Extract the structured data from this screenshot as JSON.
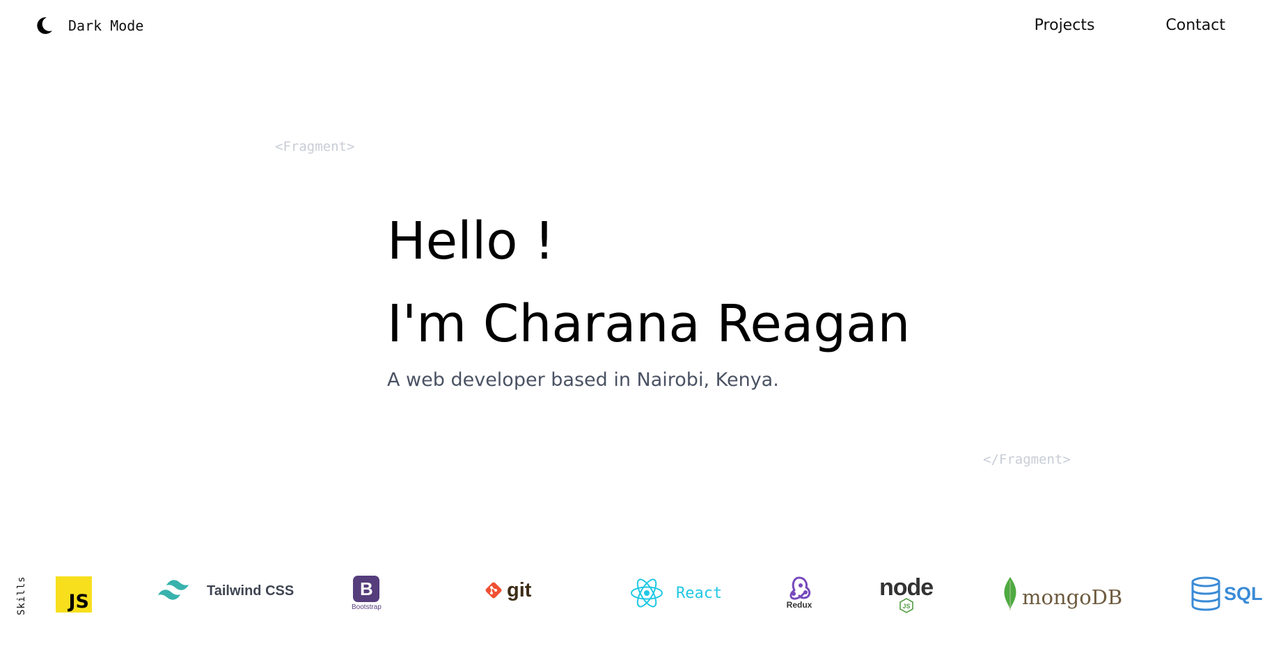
{
  "header": {
    "dark_mode_label": "Dark Mode",
    "dark_mode_icon": "moon-icon",
    "nav": [
      {
        "label": "Projects"
      },
      {
        "label": "Contact"
      }
    ]
  },
  "fragments": {
    "open": "<Fragment>",
    "close": "</Fragment>"
  },
  "hero": {
    "greeting": "Hello !",
    "name_line": "I'm Charana Reagan",
    "subtitle": "A web developer based in Nairobi, Kenya."
  },
  "skills": {
    "label": "Skills",
    "items": [
      {
        "icon": "javascript-logo",
        "text": "JS"
      },
      {
        "icon": "tailwind-logo",
        "text": "Tailwind CSS"
      },
      {
        "icon": "bootstrap-logo",
        "text": "Bootstrap",
        "mark": "B"
      },
      {
        "icon": "git-logo",
        "text": "git"
      },
      {
        "icon": "react-logo",
        "text": "React"
      },
      {
        "icon": "redux-logo",
        "text": "Redux"
      },
      {
        "icon": "node-logo",
        "text": "node",
        "sub": "JS"
      },
      {
        "icon": "mongodb-logo",
        "text": "mongoDB"
      },
      {
        "icon": "sql-logo",
        "text": "SQL"
      }
    ]
  },
  "colors": {
    "background": "#ffffff",
    "text": "#000000",
    "subtitle": "#4a5263",
    "fragment": "#c8cdd6",
    "js_yellow": "#f7df1e",
    "tailwind": "#38b2ac",
    "bootstrap": "#563d7c",
    "git": "#f05033",
    "react": "#1fc8e4",
    "redux": "#764abc",
    "node_green": "#539e43",
    "mongo_green": "#4faa41",
    "sql_blue": "#3a8bd7"
  }
}
